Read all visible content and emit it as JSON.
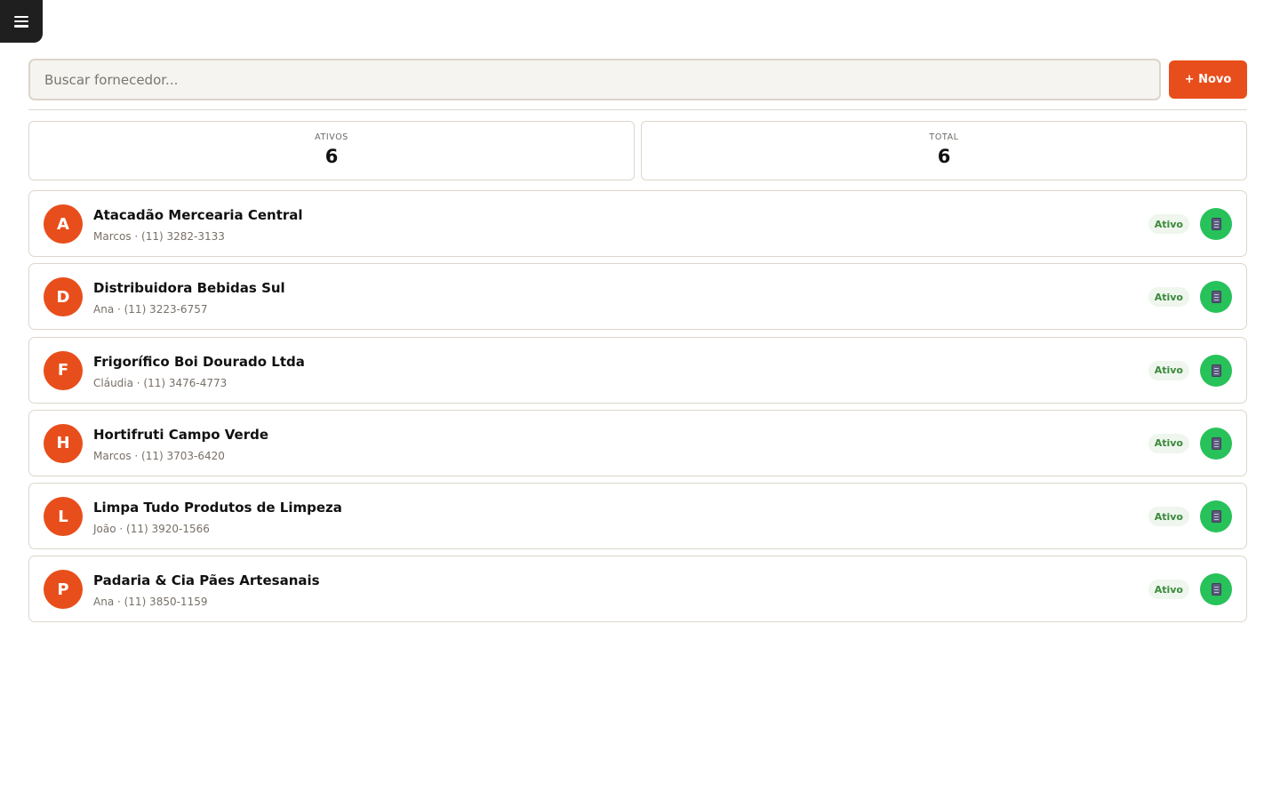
{
  "search": {
    "placeholder": "Buscar fornecedor..."
  },
  "toolbar": {
    "new_label": "+ Novo"
  },
  "stats": {
    "active_label": "ATIVOS",
    "active_value": "6",
    "total_label": "TOTAL",
    "total_value": "6"
  },
  "suppliers": [
    {
      "initial": "A",
      "name": "Atacadão Mercearia Central",
      "contact": "Marcos · (11) 3282-3133",
      "status": "Ativo"
    },
    {
      "initial": "D",
      "name": "Distribuidora Bebidas Sul",
      "contact": "Ana · (11) 3223-6757",
      "status": "Ativo"
    },
    {
      "initial": "F",
      "name": "Frigorífico Boi Dourado Ltda",
      "contact": "Cláudia · (11) 3476-4773",
      "status": "Ativo"
    },
    {
      "initial": "H",
      "name": "Hortifruti Campo Verde",
      "contact": "Marcos · (11) 3703-6420",
      "status": "Ativo"
    },
    {
      "initial": "L",
      "name": "Limpa Tudo Produtos de Limpeza",
      "contact": "João · (11) 3920-1566",
      "status": "Ativo"
    },
    {
      "initial": "P",
      "name": "Padaria & Cia Pães Artesanais",
      "contact": "Ana · (11) 3850-1159",
      "status": "Ativo"
    }
  ],
  "colors": {
    "accent": "#e84e1b",
    "success": "#27c25a",
    "menu_bg": "#1f1f1f"
  },
  "icons": {
    "menu": "hamburger-menu-icon",
    "document": "document-icon"
  }
}
